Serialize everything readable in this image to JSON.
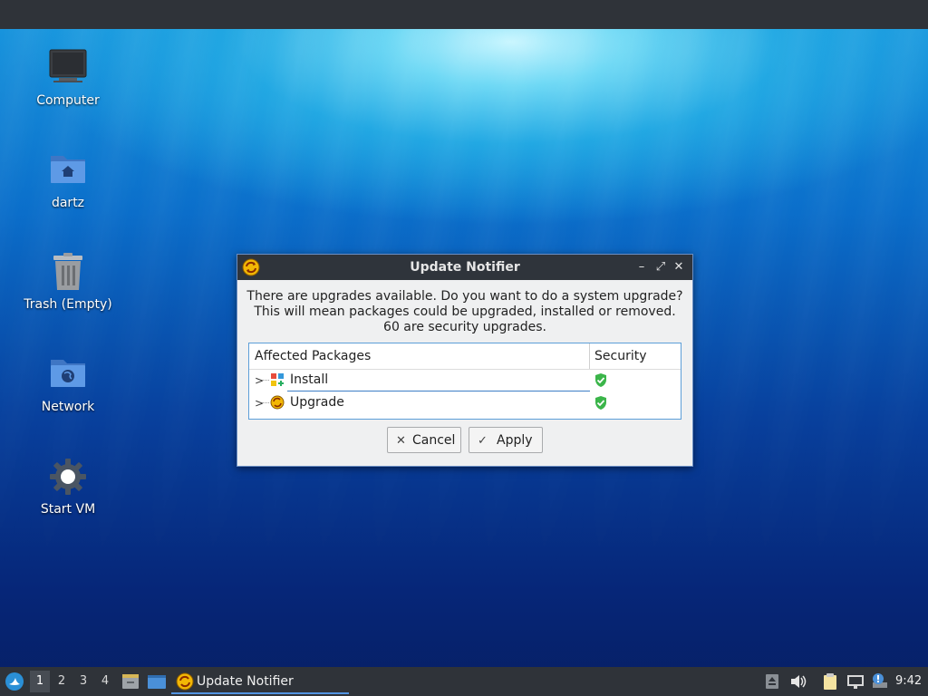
{
  "desktop": {
    "icons": [
      {
        "label": "Computer",
        "icon": "monitor-icon"
      },
      {
        "label": "dartz",
        "icon": "home-folder-icon"
      },
      {
        "label": "Trash (Empty)",
        "icon": "trash-icon"
      },
      {
        "label": "Network",
        "icon": "network-folder-icon"
      },
      {
        "label": "Start VM",
        "icon": "gear-icon"
      }
    ]
  },
  "dialog": {
    "title": "Update Notifier",
    "app_icon": "update-notifier-icon",
    "window_buttons": {
      "minimize": "–",
      "maximize": "⤢",
      "close": "✕"
    },
    "message_lines": [
      "There are upgrades available. Do you want to do a system upgrade?",
      "This will mean packages could be upgraded, installed or removed.",
      "60 are security upgrades."
    ],
    "tree": {
      "columns": [
        "Affected Packages",
        "Security"
      ],
      "rows": [
        {
          "label": "Install",
          "icon": "install-package-icon",
          "security_icon": "shield-check-icon"
        },
        {
          "label": "Upgrade",
          "icon": "upgrade-package-icon",
          "security_icon": "shield-check-icon"
        }
      ]
    },
    "buttons": {
      "cancel": {
        "label": "Cancel",
        "icon": "✕"
      },
      "apply": {
        "label": "Apply",
        "icon": "✓"
      }
    }
  },
  "taskbar": {
    "workspaces": [
      "1",
      "2",
      "3",
      "4"
    ],
    "active_workspace": "1",
    "task_label": "Update Notifier",
    "clock": "9:42",
    "colors": {
      "accent": "#5294e2",
      "shield": "#3bb54a",
      "panel": "#2f3339"
    }
  }
}
